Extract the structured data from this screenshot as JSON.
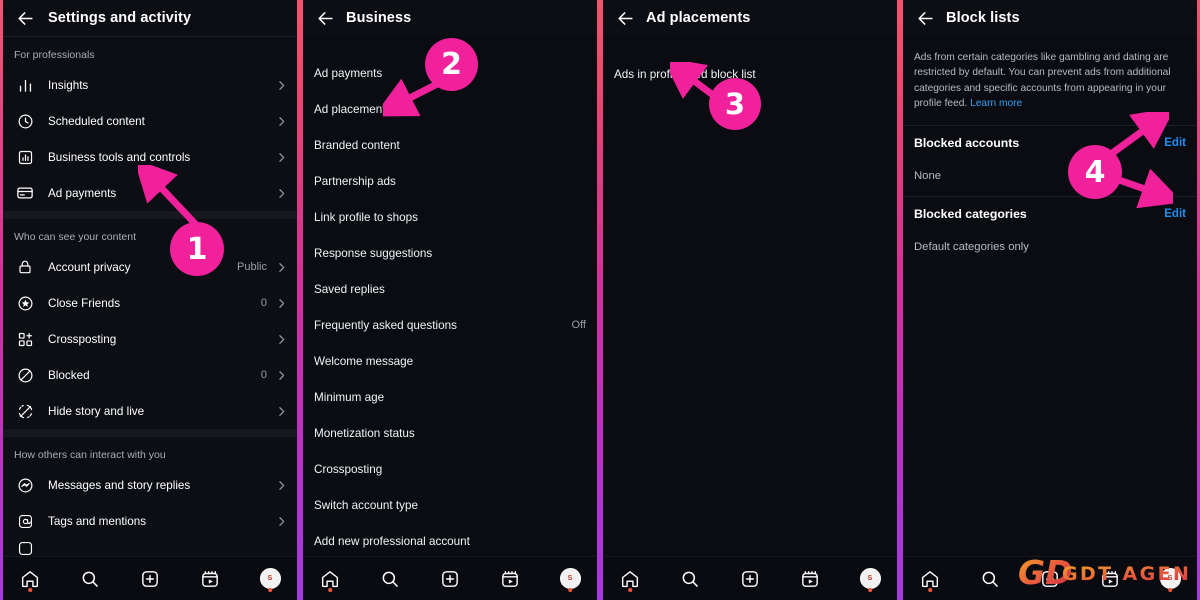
{
  "panels": [
    {
      "id": "settings-and-activity",
      "header": {
        "title": "Settings and activity",
        "back_icon": "back-arrow-icon"
      },
      "sections": [
        {
          "label": "For professionals",
          "rows": [
            {
              "icon": "bar-chart-icon",
              "label": "Insights",
              "value": "",
              "chevron": true
            },
            {
              "icon": "clock-icon",
              "label": "Scheduled content",
              "value": "",
              "chevron": true
            },
            {
              "icon": "chart-box-icon",
              "label": "Business tools and controls",
              "value": "",
              "chevron": true
            },
            {
              "icon": "credit-card-icon",
              "label": "Ad payments",
              "value": "",
              "chevron": true
            }
          ]
        },
        {
          "label": "Who can see your content",
          "rows": [
            {
              "icon": "lock-icon",
              "label": "Account privacy",
              "value": "Public",
              "chevron": true
            },
            {
              "icon": "star-circle-icon",
              "label": "Close Friends",
              "value": "0",
              "chevron": true
            },
            {
              "icon": "crosspost-icon",
              "label": "Crossposting",
              "value": "",
              "chevron": true
            },
            {
              "icon": "block-icon",
              "label": "Blocked",
              "value": "0",
              "chevron": true
            },
            {
              "icon": "hide-story-icon",
              "label": "Hide story and live",
              "value": "",
              "chevron": true
            }
          ]
        },
        {
          "label": "How others can interact with you",
          "rows": [
            {
              "icon": "messenger-icon",
              "label": "Messages and story replies",
              "value": "",
              "chevron": true
            },
            {
              "icon": "at-mention-icon",
              "label": "Tags and mentions",
              "value": "",
              "chevron": true
            }
          ]
        }
      ]
    },
    {
      "id": "business",
      "header": {
        "title": "Business",
        "back_icon": "back-arrow-icon"
      },
      "items": [
        {
          "label": "Ad payments",
          "value": ""
        },
        {
          "label": "Ad placements",
          "value": ""
        },
        {
          "label": "Branded content",
          "value": ""
        },
        {
          "label": "Partnership ads",
          "value": ""
        },
        {
          "label": "Link profile to shops",
          "value": ""
        },
        {
          "label": "Response suggestions",
          "value": ""
        },
        {
          "label": "Saved replies",
          "value": ""
        },
        {
          "label": "Frequently asked questions",
          "value": "Off"
        },
        {
          "label": "Welcome message",
          "value": ""
        },
        {
          "label": "Minimum age",
          "value": ""
        },
        {
          "label": "Monetization status",
          "value": ""
        },
        {
          "label": "Crossposting",
          "value": ""
        },
        {
          "label": "Switch account type",
          "value": ""
        },
        {
          "label": "Add new professional account",
          "value": ""
        }
      ]
    },
    {
      "id": "ad-placements",
      "header": {
        "title": "Ad placements",
        "back_icon": "back-arrow-icon"
      },
      "items": [
        {
          "label": "Ads in profile feed block list",
          "value": ""
        }
      ]
    },
    {
      "id": "block-lists",
      "header": {
        "title": "Block lists",
        "back_icon": "back-arrow-icon"
      },
      "description": "Ads from certain categories like gambling and dating are restricted by default. You can prevent ads from additional categories and specific accounts from appearing in your profile feed.",
      "description_link": "Learn more",
      "groups": [
        {
          "heading": "Blocked accounts",
          "action": "Edit",
          "value": "None"
        },
        {
          "heading": "Blocked categories",
          "action": "Edit",
          "value": "Default categories only"
        }
      ]
    }
  ],
  "bottom_nav": {
    "items": [
      {
        "icon": "home-icon",
        "label": "Home",
        "badge_dot": true
      },
      {
        "icon": "search-icon",
        "label": "Search",
        "badge_dot": false
      },
      {
        "icon": "create-icon",
        "label": "Create",
        "badge_dot": false
      },
      {
        "icon": "reels-icon",
        "label": "Reels",
        "badge_dot": false
      },
      {
        "icon": "profile-avatar-icon",
        "label": "Profile",
        "badge_dot": true
      }
    ]
  },
  "annotations": [
    {
      "number": "1",
      "target": "Business tools and controls"
    },
    {
      "number": "2",
      "target": "Ad placements"
    },
    {
      "number": "3",
      "target": "Ads in profile feed block list"
    },
    {
      "number": "4",
      "target": "Edit"
    }
  ],
  "watermark": {
    "brand": "GDT AGENCY",
    "mark": "GD"
  },
  "colors": {
    "accent_pink": "#f0219a",
    "link_blue": "#1f8df0",
    "background": "#0a0c11",
    "divider_top": "#f5536f",
    "divider_bottom": "#a63ae0"
  }
}
